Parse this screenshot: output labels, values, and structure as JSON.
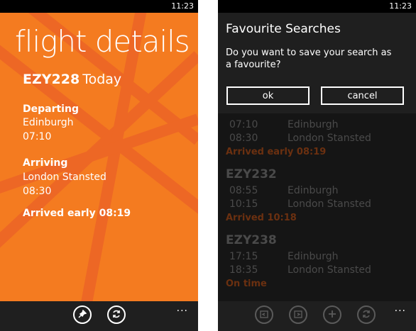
{
  "status_bar": {
    "time": "11:23"
  },
  "left": {
    "title": "flight details",
    "flight_code": "EZY228",
    "flight_day": "Today",
    "departing_label": "Departing",
    "departing_city": "Edinburgh",
    "departing_time": "07:10",
    "arriving_label": "Arriving",
    "arriving_city": "London Stansted",
    "arriving_time": "08:30",
    "arrived_status": "Arrived early 08:19",
    "app_bar": {
      "pin_icon": "pin-icon",
      "refresh_icon": "refresh-icon",
      "more": "..."
    }
  },
  "right": {
    "dialog": {
      "title": "Favourite Searches",
      "message": "Do you want to save your search as a favourite?",
      "ok_label": "ok",
      "cancel_label": "cancel"
    },
    "flights": [
      {
        "code": "",
        "dep_time": "07:10",
        "dep_city": "Edinburgh",
        "arr_time": "08:30",
        "arr_city": "London Stansted",
        "status": "Arrived early 08:19"
      },
      {
        "code": "EZY232",
        "dep_time": "08:55",
        "dep_city": "Edinburgh",
        "arr_time": "10:15",
        "arr_city": "London Stansted",
        "status": "Arrived 10:18"
      },
      {
        "code": "EZY238",
        "dep_time": "17:15",
        "dep_city": "Edinburgh",
        "arr_time": "18:35",
        "arr_city": "London Stansted",
        "status": "On time"
      }
    ],
    "app_bar": {
      "date_back_icon": "calendar-back-icon",
      "date_forward_icon": "calendar-forward-icon",
      "add_icon": "add-icon",
      "refresh_icon": "refresh-icon",
      "more": "..."
    }
  },
  "colors": {
    "accent": "#f47b20",
    "status_orange": "#6b3010"
  }
}
